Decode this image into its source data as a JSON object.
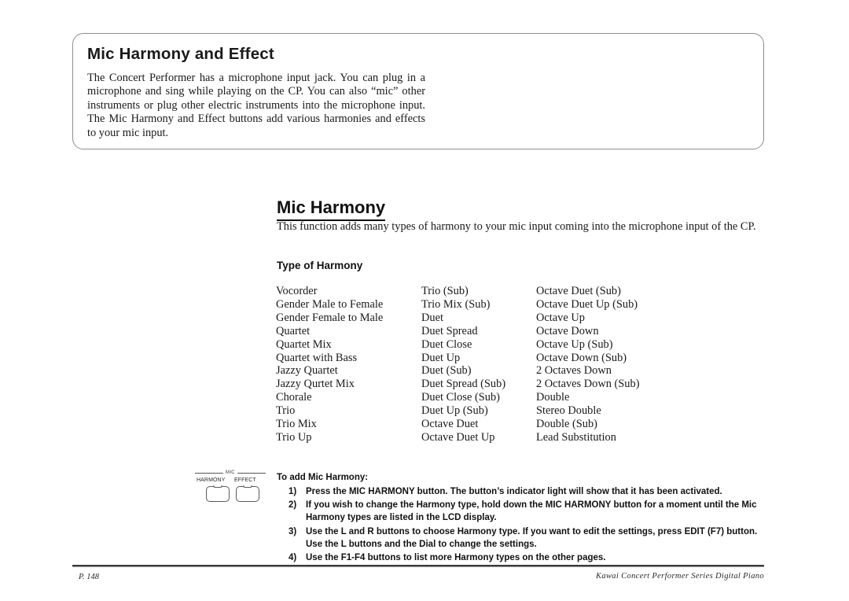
{
  "intro_box": {
    "title": "Mic Harmony and Effect",
    "paragraph": "The Concert Performer has a microphone input jack. You can plug in a microphone and sing while playing on the CP.  You can also “mic” other instruments or plug other electric instruments into the microphone input.  The Mic Harmony and Effect buttons add various harmonies and effects to your mic input."
  },
  "section": {
    "heading": "Mic Harmony",
    "intro": "This function adds many types of harmony to your mic input coming into the microphone input of the CP.",
    "subhead": "Type of Harmony"
  },
  "harmony_columns": [
    [
      "Vocorder",
      "Gender Male to Female",
      "Gender Female to Male",
      "Quartet",
      "Quartet Mix",
      "Quartet with Bass",
      "Jazzy Quartet",
      "Jazzy Qurtet Mix",
      "Chorale",
      "Trio",
      "Trio Mix",
      "Trio Up"
    ],
    [
      "Trio (Sub)",
      "Trio Mix (Sub)",
      "Duet",
      "Duet Spread",
      "Duet Close",
      "Duet Up",
      "Duet (Sub)",
      "Duet Spread (Sub)",
      "Duet Close (Sub)",
      "Duet Up (Sub)",
      "Octave Duet",
      "Octave Duet Up"
    ],
    [
      "Octave Duet (Sub)",
      "Octave Duet Up (Sub)",
      "Octave Up",
      "Octave Down",
      "Octave Up (Sub)",
      "Octave Down (Sub)",
      "2 Octaves Down",
      "2 Octaves Down (Sub)",
      "Double",
      "Stereo Double",
      "Double (Sub)",
      "Lead Substitution"
    ]
  ],
  "button_graphic": {
    "group_label": "MIC",
    "harmony_caption": "HARMONY",
    "effect_caption": "EFFECT"
  },
  "instructions": {
    "title": "To add Mic Harmony:",
    "steps": [
      {
        "number": "1)",
        "text": "Press the MIC HARMONY button.  The button’s indicator light will show that it has been activated."
      },
      {
        "number": "2)",
        "text": "If you wish to change the Harmony type, hold down the MIC HARMONY button for a moment until the Mic Harmony types are listed in the LCD display."
      },
      {
        "number": "3)",
        "text": "Use the L and R buttons to choose Harmony type.  If you want to edit the settings, press EDIT (F7) button.  Use the L buttons and the Dial to change the settings."
      },
      {
        "number": "4)",
        "text": "Use the F1-F4 buttons to list more Harmony types on the other pages."
      }
    ]
  },
  "footer": {
    "page": "P. 148",
    "product": "Kawai Concert Performer Series Digital Piano"
  }
}
